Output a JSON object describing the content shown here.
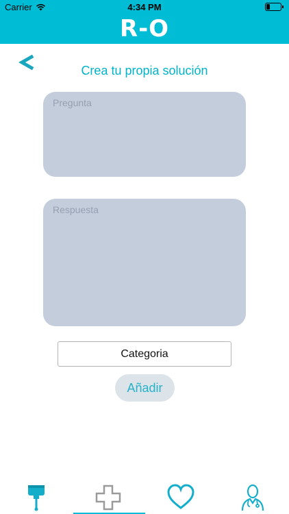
{
  "status_bar": {
    "carrier": "Carrier",
    "time": "4:34 PM"
  },
  "header": {
    "logo": "R-O",
    "background_color": "#00bcd4"
  },
  "page": {
    "back_icon": "chevron-left-icon",
    "title": "Crea tu propia solución"
  },
  "form": {
    "question_placeholder": "Pregunta",
    "question_value": "",
    "answer_placeholder": "Respuesta",
    "answer_value": "",
    "category_label": "Categoria",
    "add_button_label": "Añadir"
  },
  "tab_bar": {
    "tabs": [
      {
        "icon": "iv-bag-icon",
        "selected": false
      },
      {
        "icon": "medical-cross-icon",
        "selected": true
      },
      {
        "icon": "heart-icon",
        "selected": false
      },
      {
        "icon": "doctor-icon",
        "selected": false
      }
    ],
    "accent_color": "#00bcd4",
    "inactive_color": "#9a9a9a"
  }
}
